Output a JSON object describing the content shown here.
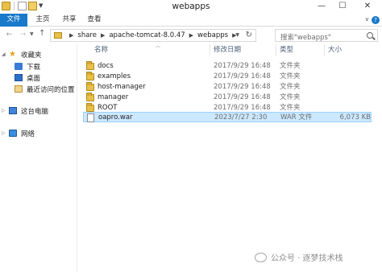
{
  "window": {
    "title": "webapps"
  },
  "caption_buttons": {
    "minimize": "—",
    "maximize": "☐",
    "close": "✕"
  },
  "ribbon": {
    "tabs": [
      {
        "label": "文件"
      },
      {
        "label": "主页"
      },
      {
        "label": "共享"
      },
      {
        "label": "查看"
      }
    ],
    "file_tab_color": "#1979ca"
  },
  "address": {
    "crumbs": [
      "share",
      "apache-tomcat-8.0.47",
      "webapps"
    ],
    "separator": "▶"
  },
  "search": {
    "placeholder": "搜索\"webapps\""
  },
  "navigation": {
    "favorites": {
      "label": "收藏夹",
      "icon": "star-icon"
    },
    "favorite_items": [
      {
        "label": "下载",
        "icon": "download-icon"
      },
      {
        "label": "桌面",
        "icon": "desktop-icon"
      },
      {
        "label": "最近访问的位置",
        "icon": "recent-places-icon"
      }
    ],
    "this_pc": {
      "label": "这台电脑",
      "icon": "computer-icon"
    },
    "network": {
      "label": "网络",
      "icon": "network-icon"
    }
  },
  "columns": {
    "name": "名称",
    "date": "修改日期",
    "type": "类型",
    "size": "大小"
  },
  "files": [
    {
      "name": "docs",
      "date": "2017/9/29 16:48",
      "type": "文件夹",
      "size": "",
      "icon": "folder-icon",
      "selected": false
    },
    {
      "name": "examples",
      "date": "2017/9/29 16:48",
      "type": "文件夹",
      "size": "",
      "icon": "folder-icon",
      "selected": false
    },
    {
      "name": "host-manager",
      "date": "2017/9/29 16:48",
      "type": "文件夹",
      "size": "",
      "icon": "folder-icon",
      "selected": false
    },
    {
      "name": "manager",
      "date": "2017/9/29 16:48",
      "type": "文件夹",
      "size": "",
      "icon": "folder-icon",
      "selected": false
    },
    {
      "name": "ROOT",
      "date": "2017/9/29 16:48",
      "type": "文件夹",
      "size": "",
      "icon": "folder-icon",
      "selected": false
    },
    {
      "name": "oapro.war",
      "date": "2023/7/27 2:30",
      "type": "WAR 文件",
      "size": "6,073 KB",
      "icon": "war-file-icon",
      "selected": true
    }
  ],
  "watermark": {
    "text": "公众号 · 逐梦技术栈"
  },
  "colors": {
    "selection_bg": "#cce8ff",
    "selection_border": "#99d1ff",
    "header_text": "#4c607a"
  }
}
